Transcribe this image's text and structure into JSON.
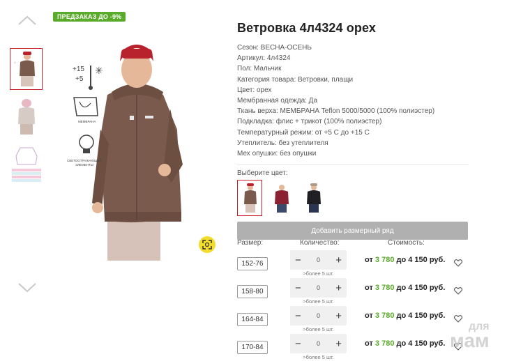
{
  "badge": "ПРЕДЗАКАЗ ДО -9%",
  "product": {
    "title": "Ветровка 4л4324 орех",
    "specs": [
      "Сезон: ВЕСНА-ОСЕНЬ",
      "Артикул: 4л4324",
      "Пол: Мальчик",
      "Категория товара: Ветровки, плащи",
      "Цвет: орех",
      "Мембранная одежда: Да",
      "Ткань верха: МЕМБРАНА Teflon 5000/5000 (100% полиэстер)",
      "Подкладка: флис + трикот (100% полиэстер)",
      "Температурный режим: от +5 С до +15 С",
      "Утеплитель: без утеплителя",
      "Мех опушки: без опушки"
    ]
  },
  "photo_labels": {
    "temp_top": "+15",
    "temp_bottom": "+5",
    "membrane": "МЕМБРАНА",
    "reflective_1": "СВЕТООТРАЖАЮЩИЕ",
    "reflective_2": "ЭЛЕМЕНТЫ"
  },
  "color_picker": {
    "label": "Выберите цвет:",
    "swatches": [
      {
        "name": "орех",
        "color": "#7a5a4c",
        "active": true
      },
      {
        "name": "бордо",
        "color": "#8b2233",
        "active": false
      },
      {
        "name": "черный",
        "color": "#1f1f24",
        "active": false
      }
    ]
  },
  "add_size_button": "Добавить размерный ряд",
  "table": {
    "size_header": "Размер:",
    "qty_header": "Количество:",
    "cost_header": "Стоимость:",
    "rows": [
      {
        "size": "152-76",
        "qty": "0",
        "more": ">более 5 шт.",
        "from": "от",
        "min": "3 780",
        "to": "до 4 150 руб."
      },
      {
        "size": "158-80",
        "qty": "0",
        "more": ">более 5 шт.",
        "from": "от",
        "min": "3 780",
        "to": "до 4 150 руб."
      },
      {
        "size": "164-84",
        "qty": "0",
        "more": ">более 5 шт.",
        "from": "от",
        "min": "3 780",
        "to": "до 4 150 руб."
      },
      {
        "size": "170-84",
        "qty": "0",
        "more": ">более 5 шт.",
        "from": "от",
        "min": "3 780",
        "to": "до 4 150 руб."
      }
    ]
  },
  "watermark": {
    "line1": "для",
    "line2": "мам"
  },
  "colors": {
    "accent_red": "#c8202a",
    "accent_green": "#5aab2a",
    "zoom_yellow": "#f3dd2c"
  }
}
